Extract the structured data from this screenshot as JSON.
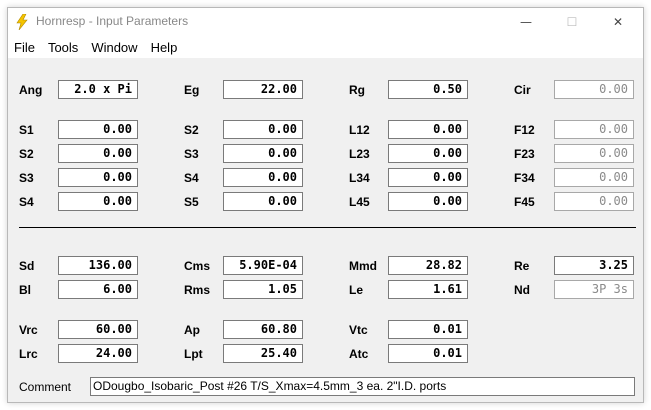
{
  "window": {
    "title": "Hornresp - Input Parameters",
    "controls": {
      "minimize": "—",
      "maximize": "☐",
      "close": "✕"
    }
  },
  "menu": [
    "File",
    "Tools",
    "Window",
    "Help"
  ],
  "params": {
    "Ang": "2.0 x Pi",
    "Eg": "22.00",
    "Rg": "0.50",
    "Cir": "0.00",
    "S1": "0.00",
    "S2": "0.00",
    "S3": "0.00",
    "S4": "0.00",
    "S2b": "0.00",
    "S3b": "0.00",
    "S4b": "0.00",
    "S5": "0.00",
    "L12": "0.00",
    "L23": "0.00",
    "L34": "0.00",
    "L45": "0.00",
    "F12": "0.00",
    "F23": "0.00",
    "F34": "0.00",
    "F45": "0.00",
    "Sd": "136.00",
    "Bl": "6.00",
    "Cms": "5.90E-04",
    "Rms": "1.05",
    "Mmd": "28.82",
    "Le": "1.61",
    "Re": "3.25",
    "Nd": "3P 3s",
    "Vrc": "60.00",
    "Lrc": "24.00",
    "Ap": "60.80",
    "Lpt": "25.40",
    "Vtc": "0.01",
    "Atc": "0.01"
  },
  "labels": {
    "Ang": "Ang",
    "Eg": "Eg",
    "Rg": "Rg",
    "Cir": "Cir",
    "S1": "S1",
    "S2": "S2",
    "S3": "S3",
    "S4": "S4",
    "S5": "S5",
    "L12": "L12",
    "L23": "L23",
    "L34": "L34",
    "L45": "L45",
    "F12": "F12",
    "F23": "F23",
    "F34": "F34",
    "F45": "F45",
    "Sd": "Sd",
    "Bl": "Bl",
    "Cms": "Cms",
    "Rms": "Rms",
    "Mmd": "Mmd",
    "Le": "Le",
    "Re": "Re",
    "Nd": "Nd",
    "Vrc": "Vrc",
    "Lrc": "Lrc",
    "Ap": "Ap",
    "Lpt": "Lpt",
    "Vtc": "Vtc",
    "Atc": "Atc",
    "comment": "Comment"
  },
  "comment": "ODougbo_Isobaric_Post #26 T/S_Xmax=4.5mm_3 ea. 2\"I.D. ports",
  "colors": {
    "icon_yellow": "#f5c400",
    "disabled_text": "#8a8a8a"
  }
}
